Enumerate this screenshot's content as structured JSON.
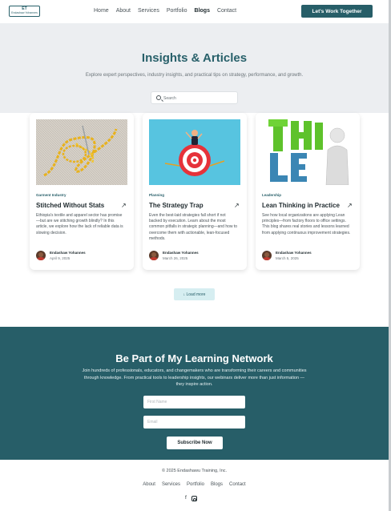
{
  "header": {
    "logo_mark": "ET",
    "logo_text": "Endashaw Yohannes",
    "nav": [
      "Home",
      "About",
      "Services",
      "Portfolio",
      "Blogs",
      "Contact"
    ],
    "active_nav": "Blogs",
    "cta": "Let's Work Together"
  },
  "hero": {
    "title": "Insights & Articles",
    "subtitle": "Explore expert perspectives, industry insights, and practical tips on strategy, performance, and growth.",
    "search_placeholder": "Search"
  },
  "posts": [
    {
      "category": "Garment Industry",
      "title": "Stitched Without Stats",
      "excerpt": "Ethiopia's textile and apparel sector has promise—but are we stitching growth blindly? In this article, we explore how the lack of reliable data is slowing decision.",
      "author": "Endashaw Yohannes",
      "date": "April 9, 2025",
      "image": "stitched-fabric-image"
    },
    {
      "category": "Planning",
      "title": "The Strategy Trap",
      "excerpt": "Even the best-laid strategies fall short if not backed by execution. Learn about the most common pitfalls in strategic planning—and how to overcome them with actionable, lean-focused methods.",
      "author": "Endashaw Yohannes",
      "date": "March 26, 2025",
      "image": "target-image"
    },
    {
      "category": "Leadership",
      "title": "Lean Thinking in Practice",
      "excerpt": "See how local organizations are applying Lean principles—from factory floors to office settings. This blog shares real stories and lessons learned from applying continuous improvement strategies.",
      "author": "Endashaw Yohannes",
      "date": "March 5, 2025",
      "image": "think-lean-image"
    }
  ],
  "load_more": "Load more",
  "newsletter": {
    "title": "Be Part of My Learning Network",
    "text": "Join hundreds of professionals, educators, and changemakers who are transforming their careers and communities through knowledge. From practical tools to leadership insights, our webinars deliver more than just information — they inspire action.",
    "name_placeholder": "First Name",
    "email_placeholder": "Email",
    "button": "Subscribe Now"
  },
  "footer": {
    "copyright": "© 2025 Endashawu Training, Inc.",
    "links": [
      "About",
      "Services",
      "Portfolio",
      "Blogs",
      "Contact"
    ],
    "socials": [
      "facebook-icon",
      "instagram-icon"
    ]
  },
  "colors": {
    "primary": "#275e68",
    "hero_bg": "#eceef1",
    "load_more_bg": "#d6eef1"
  }
}
